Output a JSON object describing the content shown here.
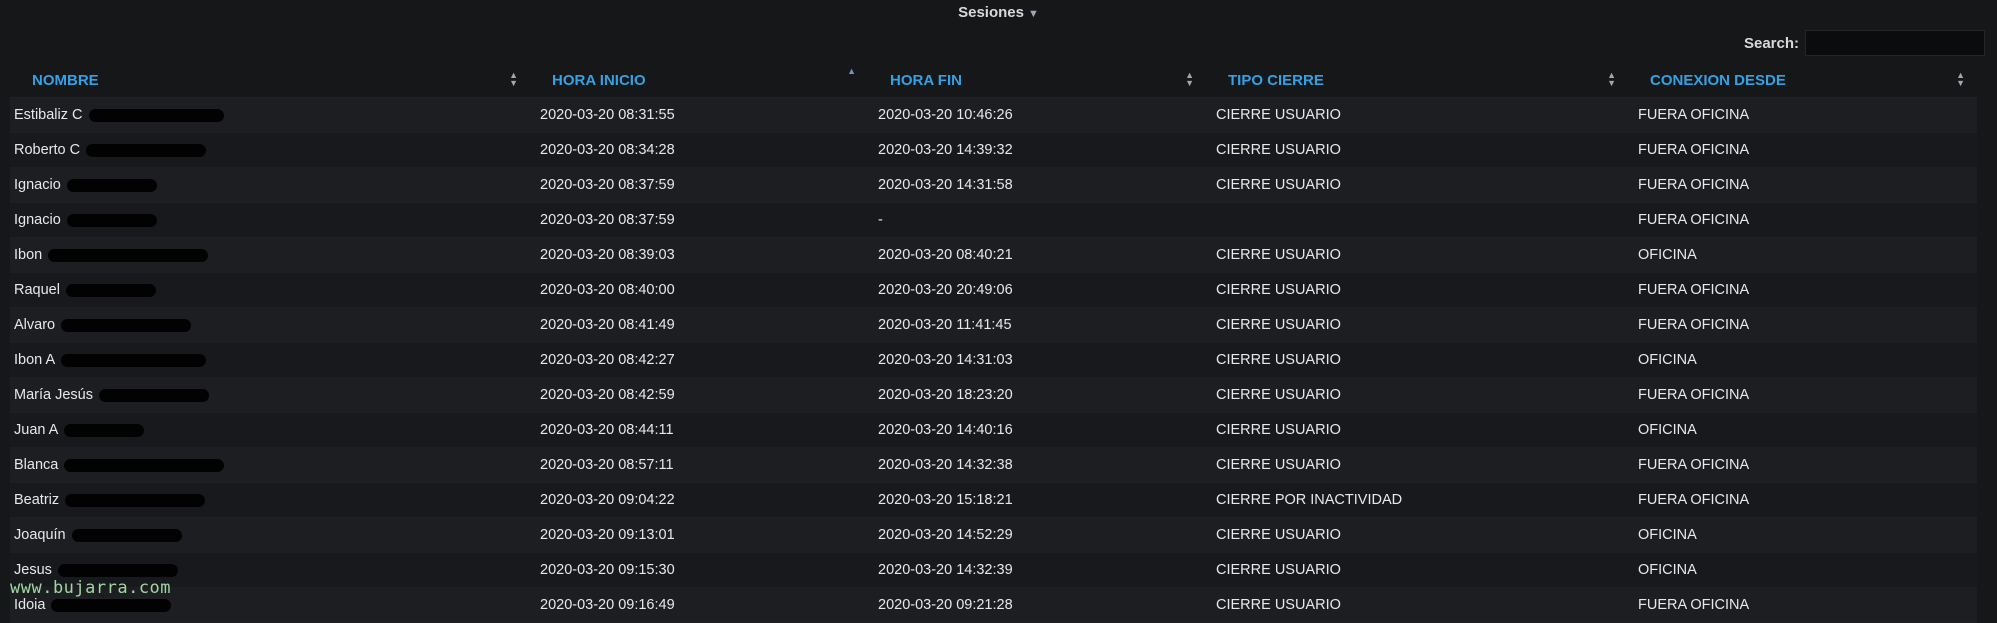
{
  "panel": {
    "title": "Sesiones",
    "caret_icon": "caret-down-icon"
  },
  "search": {
    "label": "Search:",
    "value": ""
  },
  "columns": [
    {
      "label": "NOMBRE",
      "sort": "none"
    },
    {
      "label": "HORA INICIO",
      "sort": "asc"
    },
    {
      "label": "HORA FIN",
      "sort": "none"
    },
    {
      "label": "TIPO CIERRE",
      "sort": "none"
    },
    {
      "label": "CONEXION DESDE",
      "sort": "none"
    }
  ],
  "rows": [
    {
      "nombre": "Estibaliz C",
      "inicio": "2020-03-20 08:31:55",
      "fin": "2020-03-20 10:46:26",
      "tipo": "CIERRE USUARIO",
      "desde": "FUERA OFICINA"
    },
    {
      "nombre": "Roberto C",
      "inicio": "2020-03-20 08:34:28",
      "fin": "2020-03-20 14:39:32",
      "tipo": "CIERRE USUARIO",
      "desde": "FUERA OFICINA"
    },
    {
      "nombre": "Ignacio",
      "inicio": "2020-03-20 08:37:59",
      "fin": "2020-03-20 14:31:58",
      "tipo": "CIERRE USUARIO",
      "desde": "FUERA OFICINA"
    },
    {
      "nombre": "Ignacio",
      "inicio": "2020-03-20 08:37:59",
      "fin": "-",
      "tipo": "",
      "desde": "FUERA OFICINA"
    },
    {
      "nombre": "Ibon",
      "inicio": "2020-03-20 08:39:03",
      "fin": "2020-03-20 08:40:21",
      "tipo": "CIERRE USUARIO",
      "desde": "OFICINA"
    },
    {
      "nombre": "Raquel",
      "inicio": "2020-03-20 08:40:00",
      "fin": "2020-03-20 20:49:06",
      "tipo": "CIERRE USUARIO",
      "desde": "FUERA OFICINA"
    },
    {
      "nombre": "Alvaro",
      "inicio": "2020-03-20 08:41:49",
      "fin": "2020-03-20 11:41:45",
      "tipo": "CIERRE USUARIO",
      "desde": "FUERA OFICINA"
    },
    {
      "nombre": "Ibon A",
      "inicio": "2020-03-20 08:42:27",
      "fin": "2020-03-20 14:31:03",
      "tipo": "CIERRE USUARIO",
      "desde": "OFICINA"
    },
    {
      "nombre": "María Jesús",
      "inicio": "2020-03-20 08:42:59",
      "fin": "2020-03-20 18:23:20",
      "tipo": "CIERRE USUARIO",
      "desde": "FUERA OFICINA"
    },
    {
      "nombre": "Juan A",
      "inicio": "2020-03-20 08:44:11",
      "fin": "2020-03-20 14:40:16",
      "tipo": "CIERRE USUARIO",
      "desde": "OFICINA"
    },
    {
      "nombre": "Blanca",
      "inicio": "2020-03-20 08:57:11",
      "fin": "2020-03-20 14:32:38",
      "tipo": "CIERRE USUARIO",
      "desde": "FUERA OFICINA"
    },
    {
      "nombre": "Beatriz",
      "inicio": "2020-03-20 09:04:22",
      "fin": "2020-03-20 15:18:21",
      "tipo": "CIERRE POR INACTIVIDAD",
      "desde": "FUERA OFICINA"
    },
    {
      "nombre": "Joaquín",
      "inicio": "2020-03-20 09:13:01",
      "fin": "2020-03-20 14:52:29",
      "tipo": "CIERRE USUARIO",
      "desde": "OFICINA"
    },
    {
      "nombre": "Jesus",
      "inicio": "2020-03-20 09:15:30",
      "fin": "2020-03-20 14:32:39",
      "tipo": "CIERRE USUARIO",
      "desde": "OFICINA"
    },
    {
      "nombre": "Idoia",
      "inicio": "2020-03-20 09:16:49",
      "fin": "2020-03-20 09:21:28",
      "tipo": "CIERRE USUARIO",
      "desde": "FUERA OFICINA"
    }
  ],
  "watermark": "www.bujarra.com"
}
